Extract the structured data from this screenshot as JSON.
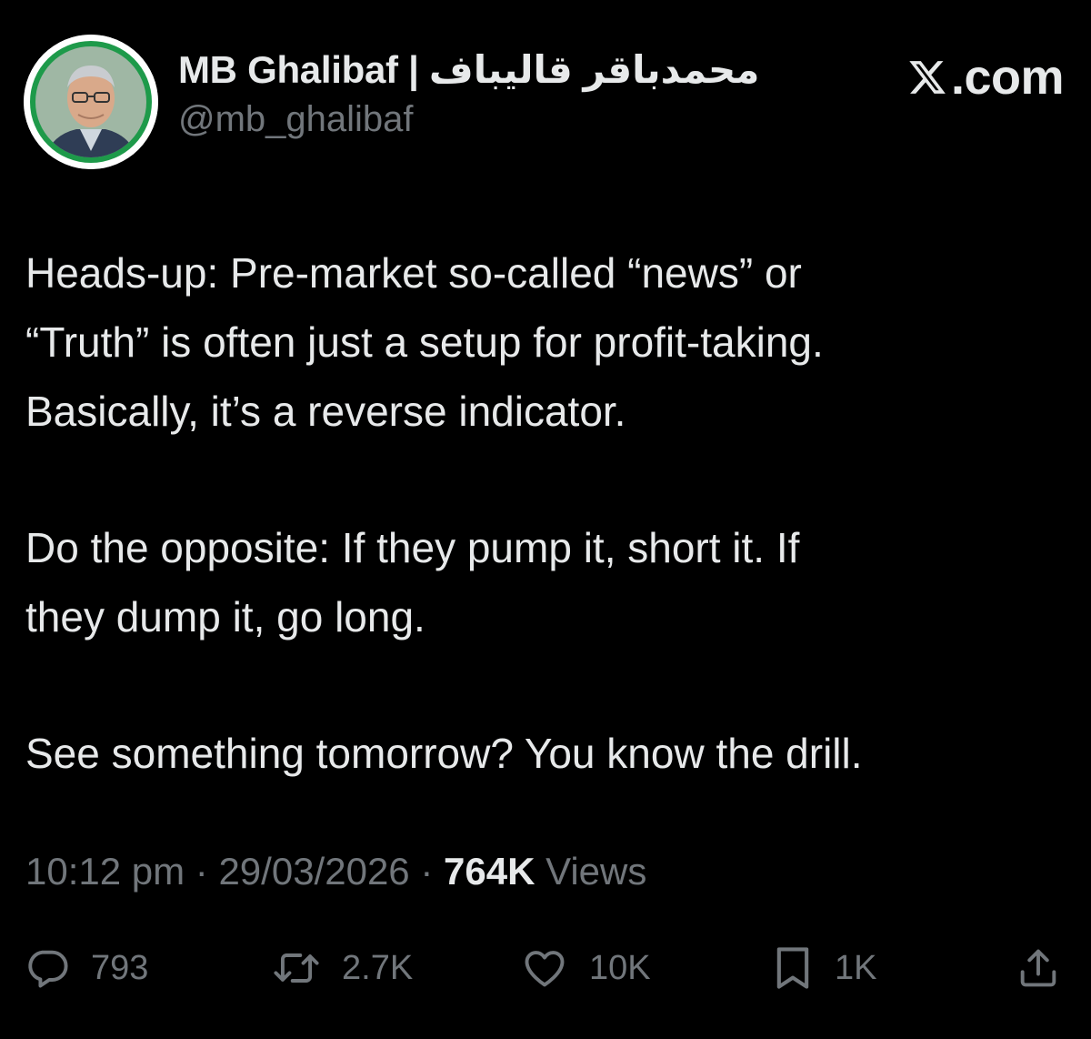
{
  "author": {
    "display_name": "MB Ghalibaf | محمدباقر قالیباف",
    "handle": "@mb_ghalibaf",
    "avatar_ring_color": "#1e9a4a"
  },
  "brand": {
    "label": ".com",
    "icon": "x-logo-icon"
  },
  "tweet": {
    "paragraphs": [
      "Heads-up: Pre-market so-called “news” or\n“Truth” is often just a setup for profit-taking.\nBasically, it’s a reverse indicator.",
      "Do the opposite: If they pump it, short it. If\nthey dump it, go long.",
      "See something tomorrow? You know the drill."
    ]
  },
  "meta": {
    "time": "10:12 pm",
    "separator": " · ",
    "date": "29/03/2026",
    "views_count": "764K",
    "views_label": " Views"
  },
  "actions": {
    "reply": {
      "icon": "reply-icon",
      "count": "793"
    },
    "retweet": {
      "icon": "retweet-icon",
      "count": "2.7K"
    },
    "like": {
      "icon": "heart-icon",
      "count": "10K"
    },
    "bookmark": {
      "icon": "bookmark-icon",
      "count": "1K"
    },
    "share": {
      "icon": "share-icon"
    }
  },
  "colors": {
    "background": "#000000",
    "text": "#e7e9ea",
    "muted": "#71767b"
  }
}
